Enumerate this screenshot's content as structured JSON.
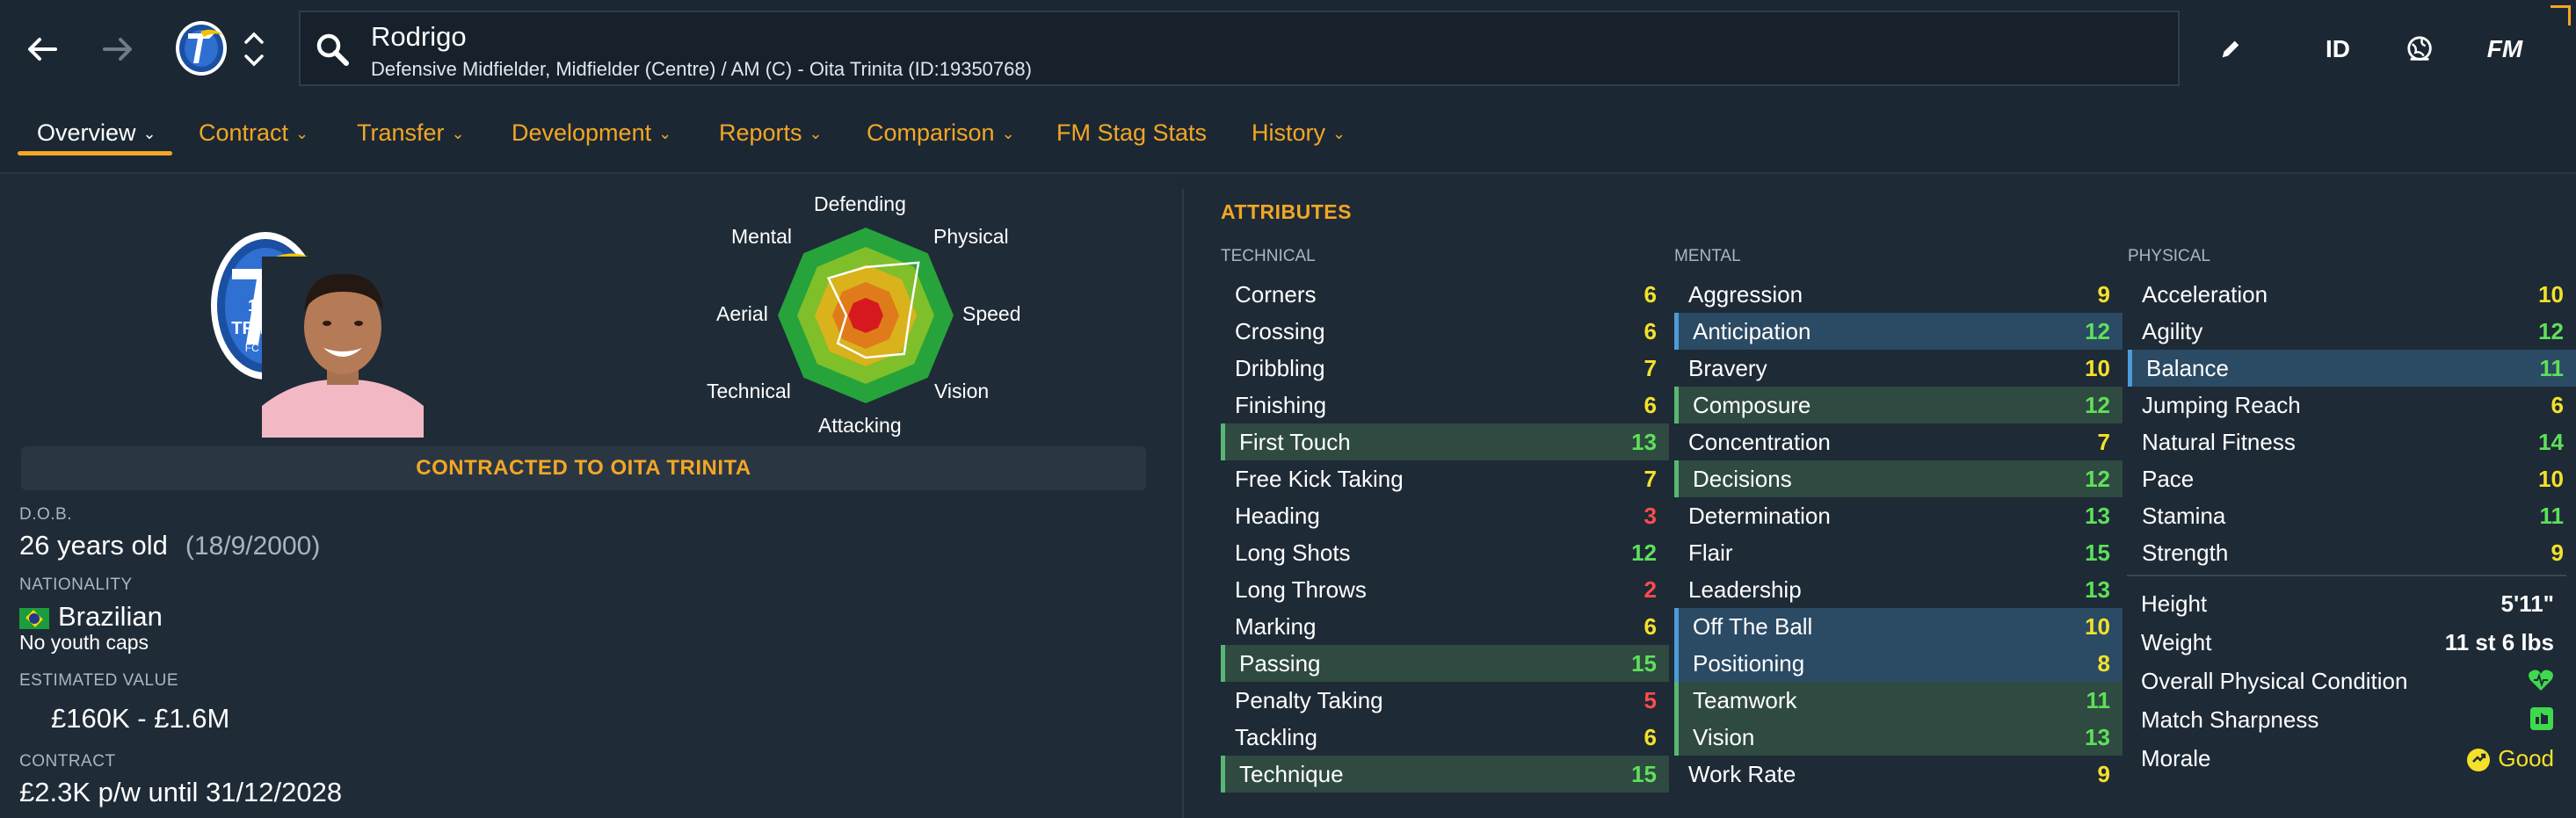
{
  "header": {
    "player_name": "Rodrigo",
    "player_sub": "Defensive Midfielder, Midfielder (Centre) / AM (C) - Oita Trinita (ID:19350768)",
    "tools": {
      "id_label": "ID",
      "fm_label": "FM"
    }
  },
  "tabs": [
    {
      "label": "Overview",
      "chevron": true
    },
    {
      "label": "Contract",
      "chevron": true
    },
    {
      "label": "Transfer",
      "chevron": true
    },
    {
      "label": "Development",
      "chevron": true
    },
    {
      "label": "Reports",
      "chevron": true
    },
    {
      "label": "Comparison",
      "chevron": true
    },
    {
      "label": "FM Stag Stats",
      "chevron": false
    },
    {
      "label": "History",
      "chevron": true
    }
  ],
  "overview": {
    "contract_banner": "CONTRACTED TO OITA TRINITA",
    "dob_label": "D.O.B.",
    "age": "26 years old",
    "dob": "(18/9/2000)",
    "nationality_label": "NATIONALITY",
    "nationality": "Brazilian",
    "youth_caps": "No youth caps",
    "value_label": "ESTIMATED VALUE",
    "value": "£160K - £1.6M",
    "contract_label": "CONTRACT",
    "contract": "£2.3K p/w until 31/12/2028",
    "crest_text": {
      "year": "1994",
      "club": "TRINITA",
      "sub": "FC OITA"
    }
  },
  "radar": {
    "labels": [
      "Defending",
      "Physical",
      "Speed",
      "Vision",
      "Attacking",
      "Technical",
      "Aerial",
      "Mental"
    ],
    "levels": [
      0.55,
      0.85,
      0.5,
      0.62,
      0.48,
      0.45,
      0.22,
      0.6
    ]
  },
  "attributes": {
    "title": "ATTRIBUTES",
    "technical": {
      "heading": "TECHNICAL",
      "items": [
        {
          "name": "Corners",
          "value": "6",
          "hl": ""
        },
        {
          "name": "Crossing",
          "value": "6",
          "hl": ""
        },
        {
          "name": "Dribbling",
          "value": "7",
          "hl": ""
        },
        {
          "name": "Finishing",
          "value": "6",
          "hl": ""
        },
        {
          "name": "First Touch",
          "value": "13",
          "hl": "green"
        },
        {
          "name": "Free Kick Taking",
          "value": "7",
          "hl": ""
        },
        {
          "name": "Heading",
          "value": "3",
          "hl": ""
        },
        {
          "name": "Long Shots",
          "value": "12",
          "hl": ""
        },
        {
          "name": "Long Throws",
          "value": "2",
          "hl": ""
        },
        {
          "name": "Marking",
          "value": "6",
          "hl": ""
        },
        {
          "name": "Passing",
          "value": "15",
          "hl": "green"
        },
        {
          "name": "Penalty Taking",
          "value": "5",
          "hl": ""
        },
        {
          "name": "Tackling",
          "value": "6",
          "hl": ""
        },
        {
          "name": "Technique",
          "value": "15",
          "hl": "green"
        }
      ]
    },
    "mental": {
      "heading": "MENTAL",
      "items": [
        {
          "name": "Aggression",
          "value": "9",
          "hl": ""
        },
        {
          "name": "Anticipation",
          "value": "12",
          "hl": "blue"
        },
        {
          "name": "Bravery",
          "value": "10",
          "hl": ""
        },
        {
          "name": "Composure",
          "value": "12",
          "hl": "green"
        },
        {
          "name": "Concentration",
          "value": "7",
          "hl": ""
        },
        {
          "name": "Decisions",
          "value": "12",
          "hl": "green"
        },
        {
          "name": "Determination",
          "value": "13",
          "hl": ""
        },
        {
          "name": "Flair",
          "value": "15",
          "hl": ""
        },
        {
          "name": "Leadership",
          "value": "13",
          "hl": ""
        },
        {
          "name": "Off The Ball",
          "value": "10",
          "hl": "blue"
        },
        {
          "name": "Positioning",
          "value": "8",
          "hl": "blue"
        },
        {
          "name": "Teamwork",
          "value": "11",
          "hl": "green"
        },
        {
          "name": "Vision",
          "value": "13",
          "hl": "green"
        },
        {
          "name": "Work Rate",
          "value": "9",
          "hl": ""
        }
      ]
    },
    "physical": {
      "heading": "PHYSICAL",
      "items": [
        {
          "name": "Acceleration",
          "value": "10",
          "hl": ""
        },
        {
          "name": "Agility",
          "value": "12",
          "hl": ""
        },
        {
          "name": "Balance",
          "value": "11",
          "hl": "blue"
        },
        {
          "name": "Jumping Reach",
          "value": "6",
          "hl": ""
        },
        {
          "name": "Natural Fitness",
          "value": "14",
          "hl": ""
        },
        {
          "name": "Pace",
          "value": "10",
          "hl": ""
        },
        {
          "name": "Stamina",
          "value": "11",
          "hl": ""
        },
        {
          "name": "Strength",
          "value": "9",
          "hl": ""
        }
      ]
    },
    "physical_info": {
      "height_label": "Height",
      "height": "5'11\"",
      "weight_label": "Weight",
      "weight": "11 st 6 lbs",
      "condition_label": "Overall Physical Condition",
      "sharpness_label": "Match Sharpness",
      "morale_label": "Morale",
      "morale": "Good"
    }
  },
  "colors": {
    "accent": "#f4a624",
    "red": "#ff4b4b",
    "yellow": "#f4e12a",
    "green": "#5ee05a"
  }
}
